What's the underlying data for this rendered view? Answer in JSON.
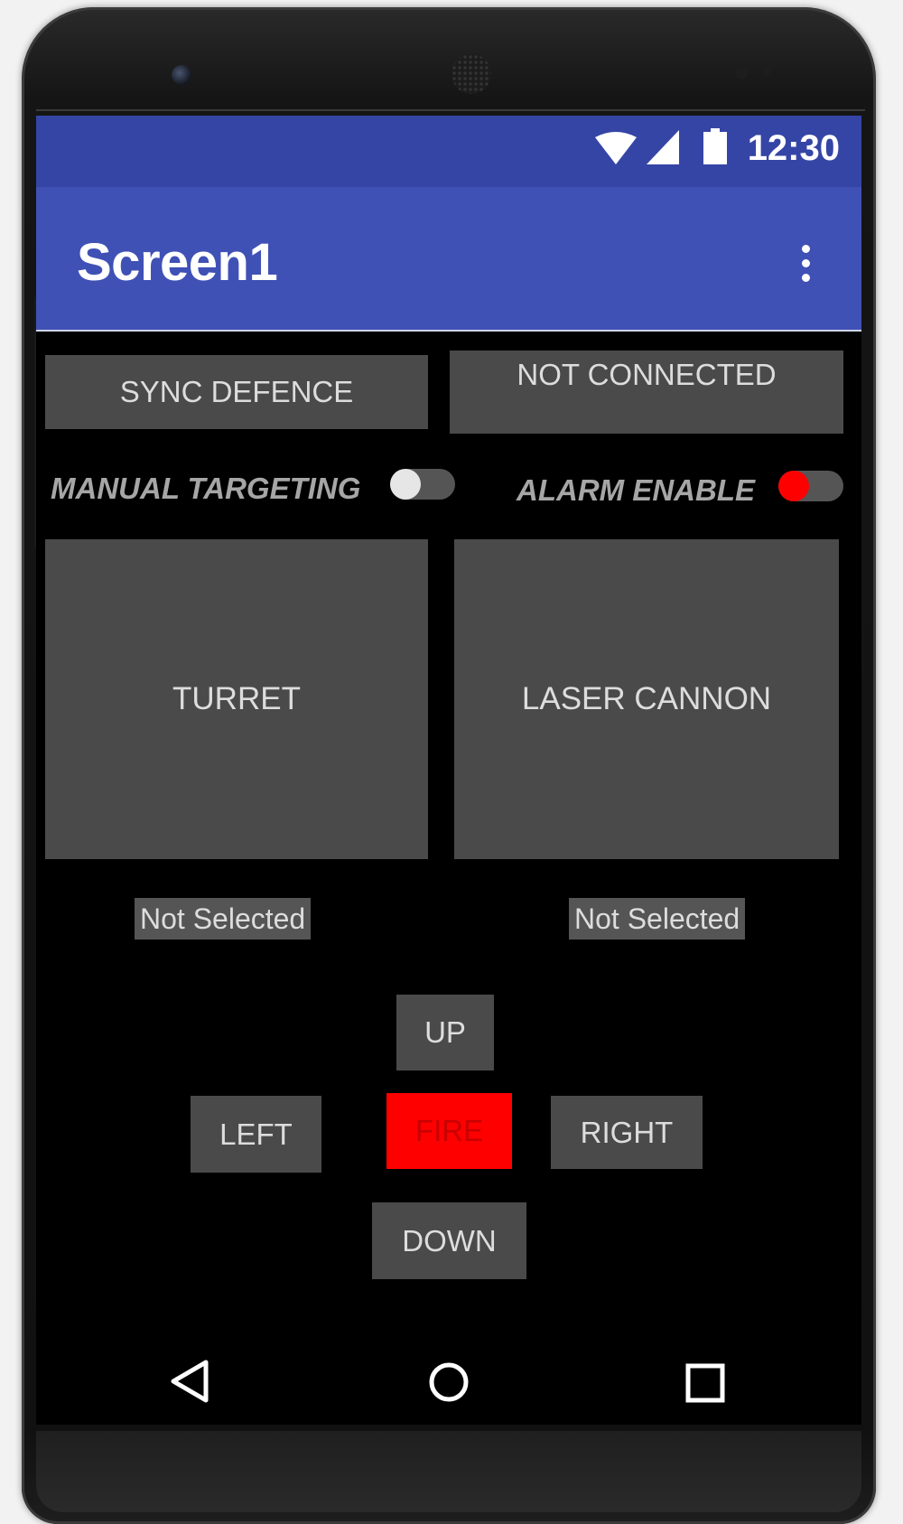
{
  "status_bar": {
    "time": "12:30"
  },
  "app_bar": {
    "title": "Screen1"
  },
  "buttons": {
    "sync": "SYNC DEFENCE",
    "connection": "NOT CONNECTED",
    "turret": "TURRET",
    "laser": "LASER CANNON",
    "up": "UP",
    "left": "LEFT",
    "fire": "FIRE",
    "right": "RIGHT",
    "down": "DOWN"
  },
  "switches": {
    "manual_targeting": {
      "label": "MANUAL TARGETING",
      "on": false
    },
    "alarm_enable": {
      "label": "ALARM ENABLE",
      "on": false,
      "thumb_color": "#ff0000"
    }
  },
  "status_labels": {
    "turret": "Not Selected",
    "laser": "Not Selected"
  },
  "colors": {
    "status_bar": "#3545a6",
    "app_bar": "#3f51b5",
    "button": "#4a4a4a",
    "fire_button": "#ff0000"
  }
}
